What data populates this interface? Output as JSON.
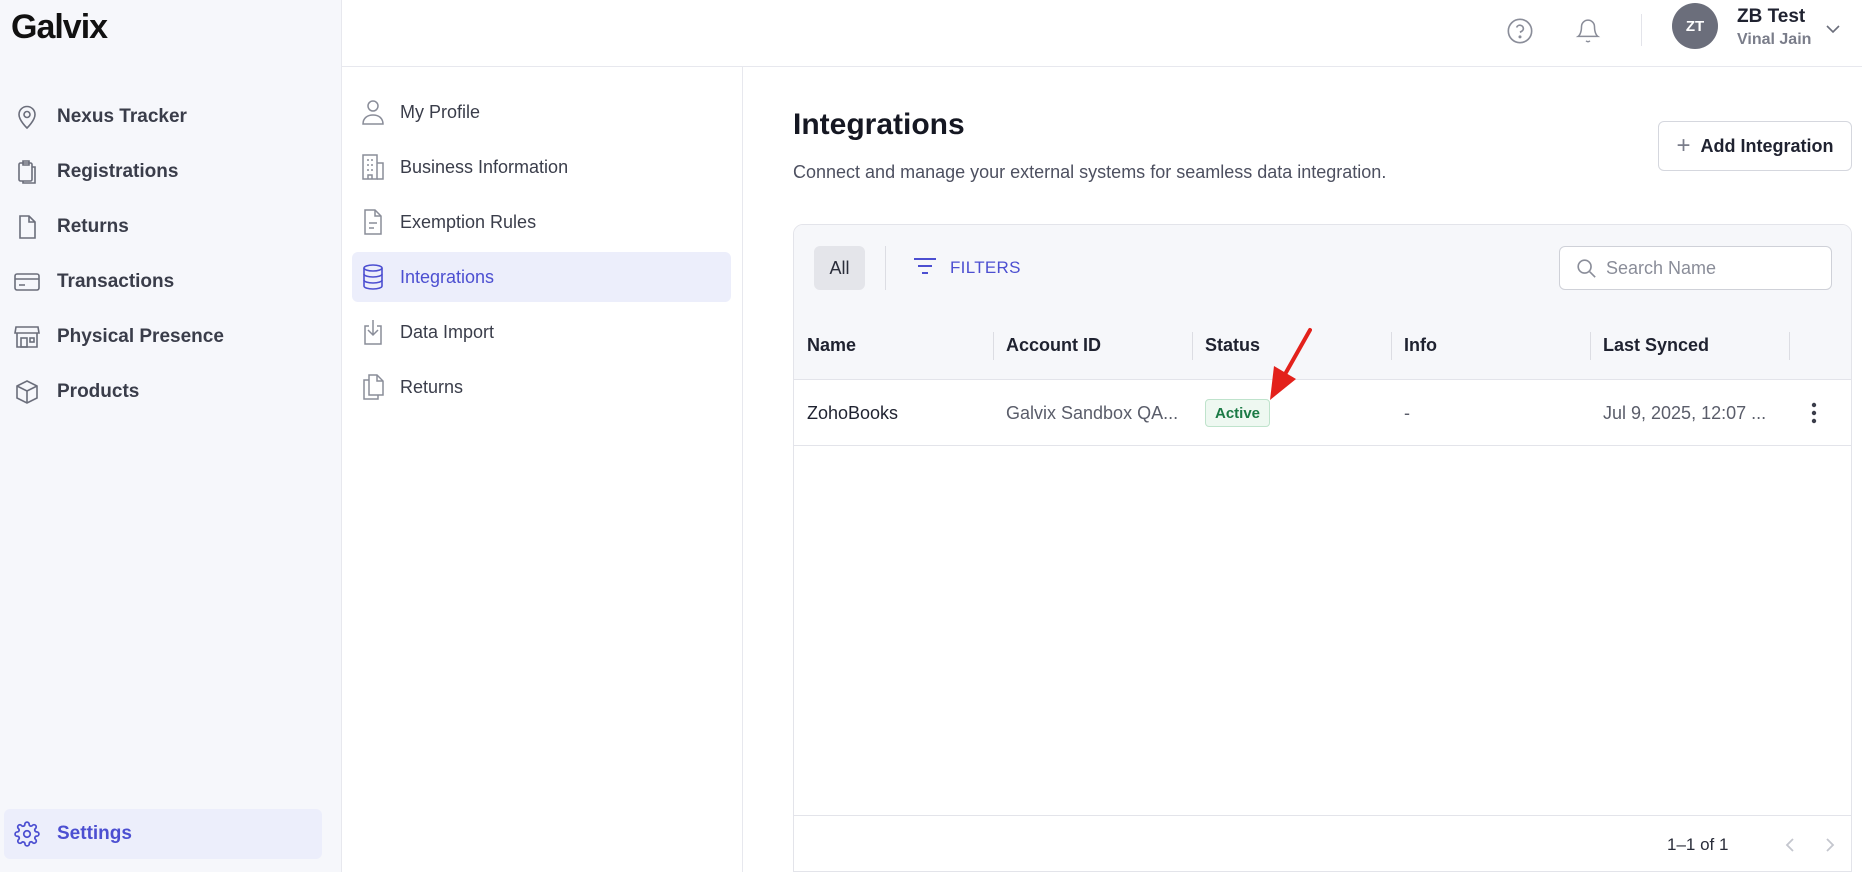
{
  "app": {
    "logo": "Galvix"
  },
  "sidebar": {
    "items": [
      {
        "label": "Nexus Tracker",
        "icon": "location-pin-icon"
      },
      {
        "label": "Registrations",
        "icon": "clipboard-icon"
      },
      {
        "label": "Returns",
        "icon": "document-icon"
      },
      {
        "label": "Transactions",
        "icon": "credit-card-icon"
      },
      {
        "label": "Physical Presence",
        "icon": "store-icon"
      },
      {
        "label": "Products",
        "icon": "box-icon"
      }
    ],
    "settings": {
      "label": "Settings",
      "icon": "gear-icon",
      "active": true
    }
  },
  "header": {
    "help_icon": "help-circle-icon",
    "notifications_icon": "bell-icon",
    "user": {
      "initials": "ZT",
      "name": "ZB Test",
      "subtitle": "Vinal Jain"
    }
  },
  "settings_nav": {
    "items": [
      {
        "label": "My Profile",
        "icon": "user-icon"
      },
      {
        "label": "Business Information",
        "icon": "building-icon"
      },
      {
        "label": "Exemption Rules",
        "icon": "document-lines-icon"
      },
      {
        "label": "Integrations",
        "icon": "database-icon",
        "active": true
      },
      {
        "label": "Data Import",
        "icon": "import-icon"
      },
      {
        "label": "Returns",
        "icon": "copy-documents-icon"
      }
    ]
  },
  "main": {
    "title": "Integrations",
    "subtitle": "Connect and manage your external systems for seamless data integration.",
    "add_button": "Add Integration",
    "toolbar": {
      "chip_all": "All",
      "filters": "FILTERS",
      "search_placeholder": "Search Name"
    },
    "table": {
      "columns": [
        "Name",
        "Account ID",
        "Status",
        "Info",
        "Last Synced"
      ],
      "rows": [
        {
          "name": "ZohoBooks",
          "account_id": "Galvix Sandbox QA...",
          "status": "Active",
          "info": "-",
          "last_synced": "Jul 9, 2025, 12:07 ..."
        }
      ]
    },
    "pagination": {
      "text": "1–1 of 1"
    }
  },
  "colors": {
    "accent": "#4c4fd1",
    "active_bg": "#eceefb",
    "status_active": "#1b7a45",
    "annotation_arrow": "#e3211b"
  }
}
